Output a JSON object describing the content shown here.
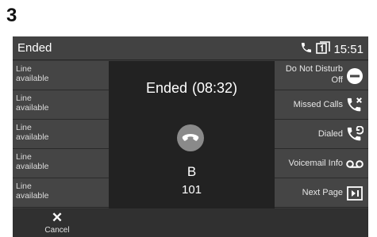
{
  "step_number": "3",
  "status_bar": {
    "title": "Ended",
    "time": "15:51"
  },
  "line_keys": [
    {
      "line1": "Line",
      "line2": "available"
    },
    {
      "line1": "Line",
      "line2": "available"
    },
    {
      "line1": "Line",
      "line2": "available"
    },
    {
      "line1": "Line",
      "line2": "available"
    },
    {
      "line1": "Line",
      "line2": "available"
    }
  ],
  "call": {
    "status": "Ended",
    "duration": "(08:32)",
    "contact_name": "B",
    "contact_number": "101"
  },
  "soft_keys": {
    "do_not_disturb": {
      "label": "Do Not Disturb",
      "state": "Off",
      "icon": "dnd-icon"
    },
    "missed_calls": {
      "label": "Missed Calls",
      "icon": "missed-call-icon"
    },
    "dialed": {
      "label": "Dialed",
      "icon": "dialed-call-icon"
    },
    "voicemail_info": {
      "label": "Voicemail Info",
      "icon": "voicemail-icon"
    },
    "next_page": {
      "label": "Next Page",
      "icon": "next-page-icon"
    }
  },
  "bottom_bar": {
    "cancel_label": "Cancel"
  },
  "colors": {
    "screen_bg": "#3a3a3a",
    "key_bg": "#454545",
    "center_bg": "#222222",
    "hangup_bg": "#8a8a8a",
    "text": "#ffffff"
  }
}
